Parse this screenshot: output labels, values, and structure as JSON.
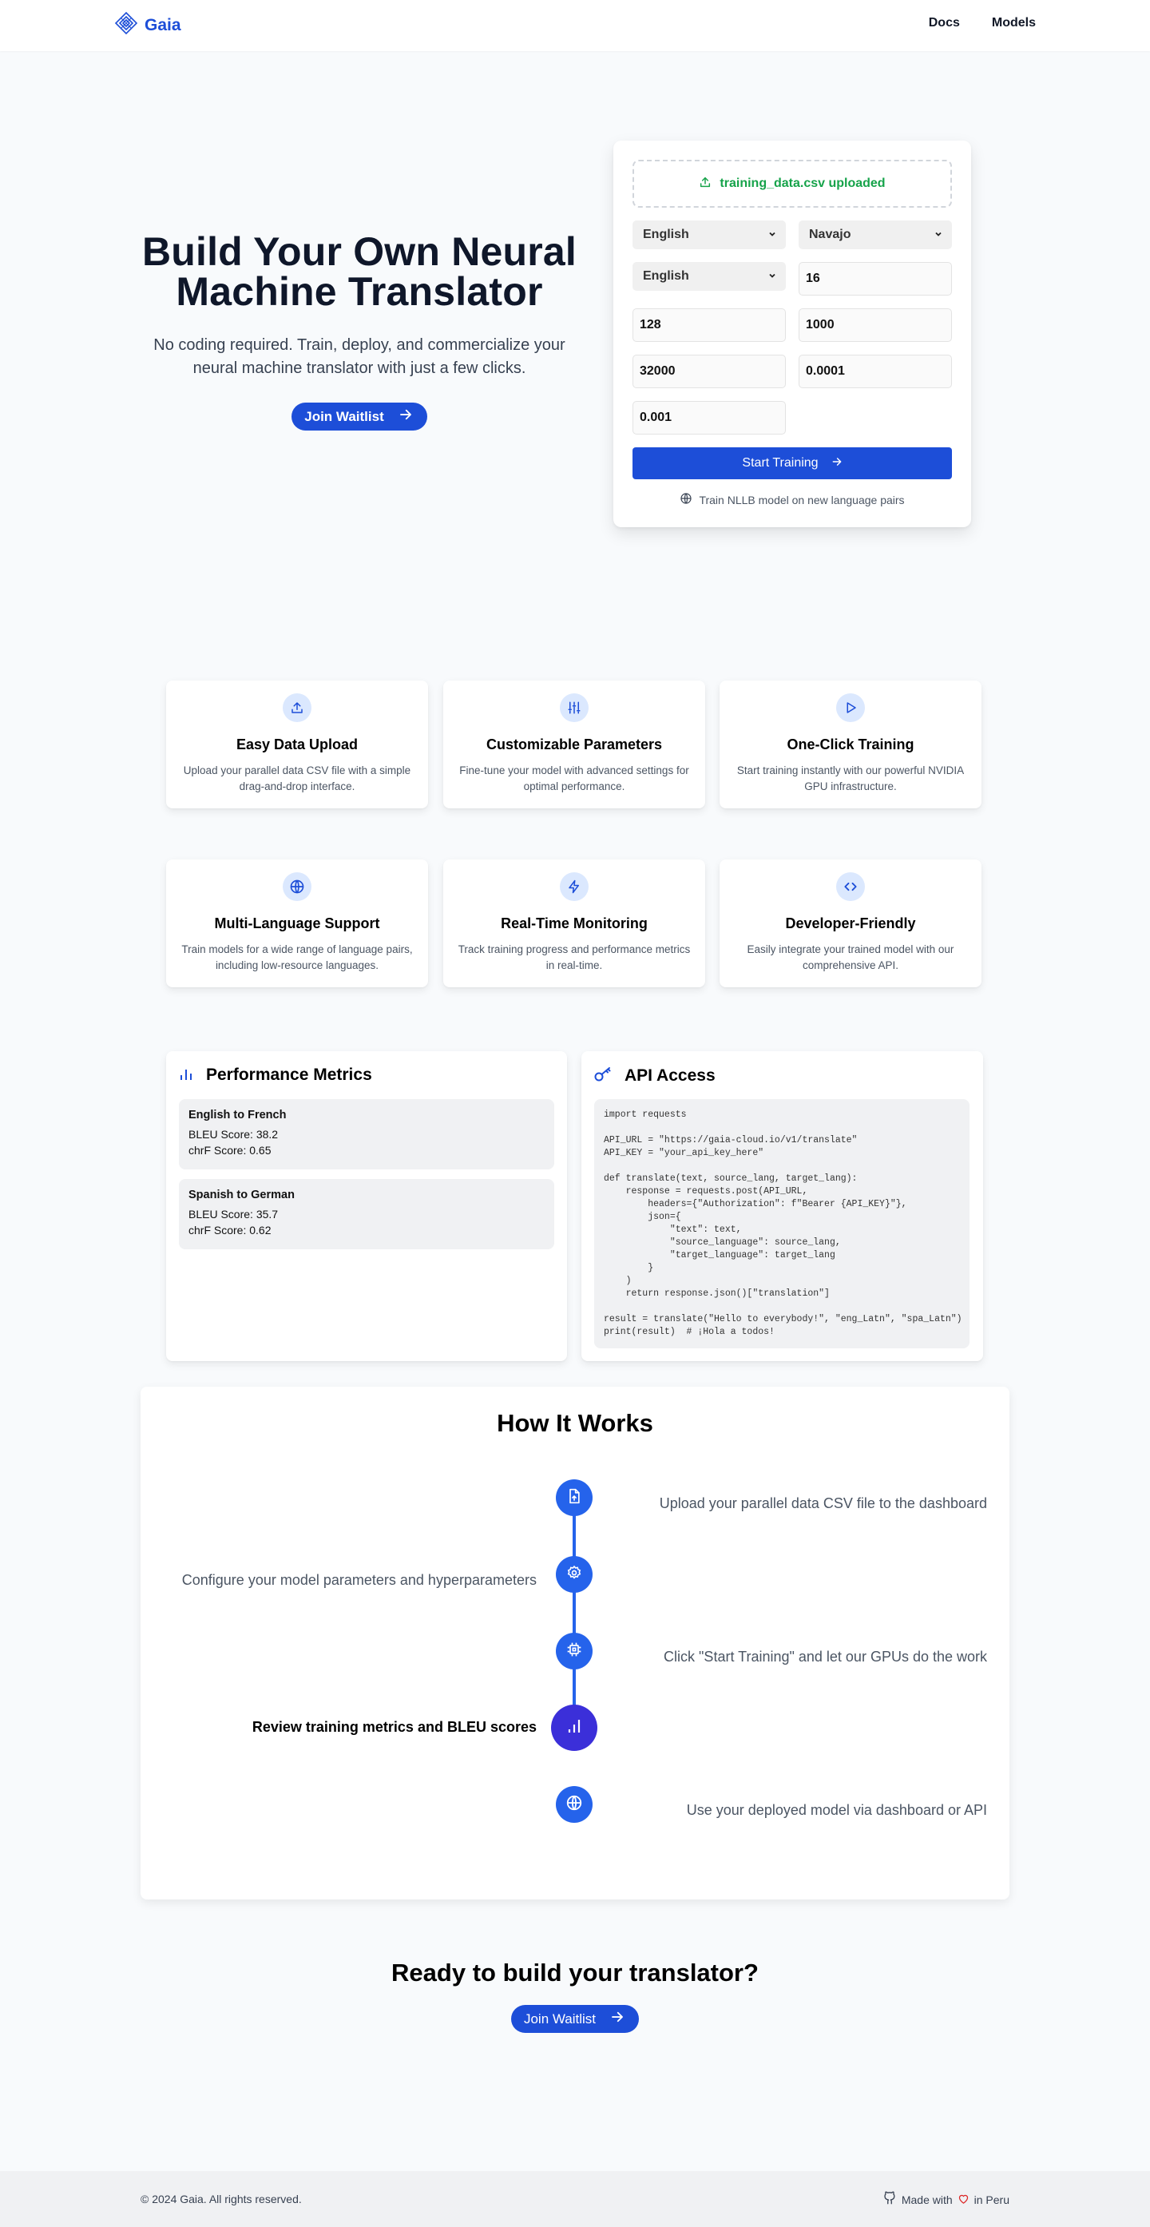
{
  "nav": {
    "brand": "Gaia",
    "links": [
      "Docs",
      "Models"
    ]
  },
  "hero": {
    "title": "Build Your Own Neural Machine Translator",
    "subtitle": "No coding required. Train, deploy, and commercialize your neural machine translator with just a few clicks.",
    "cta_label": "Join Waitlist"
  },
  "training_form": {
    "upload_status": "training_data.csv uploaded",
    "source_language": "English",
    "target_language": "Navajo",
    "third_language": "English",
    "param_values": [
      "16",
      "128",
      "1000",
      "32000",
      "0.0001",
      "0.001"
    ],
    "start_label": "Start Training",
    "note": "Train NLLB model on new language pairs"
  },
  "features": [
    {
      "icon": "upload-icon",
      "title": "Easy Data Upload",
      "desc": "Upload your parallel data CSV file with a simple drag-and-drop interface."
    },
    {
      "icon": "sliders-icon",
      "title": "Customizable Parameters",
      "desc": "Fine-tune your model with advanced settings for optimal performance."
    },
    {
      "icon": "play-icon",
      "title": "One-Click Training",
      "desc": "Start training instantly with our powerful NVIDIA GPU infrastructure."
    },
    {
      "icon": "globe-icon",
      "title": "Multi-Language Support",
      "desc": "Train models for a wide range of language pairs, including low-resource languages."
    },
    {
      "icon": "zap-icon",
      "title": "Real-Time Monitoring",
      "desc": "Track training progress and performance metrics in real-time."
    },
    {
      "icon": "code-icon",
      "title": "Developer-Friendly",
      "desc": "Easily integrate your trained model with our comprehensive API."
    }
  ],
  "metrics": {
    "title": "Performance Metrics",
    "items": [
      {
        "pair": "English to French",
        "bleu": "BLEU Score: 38.2",
        "chrf": "chrF Score: 0.65"
      },
      {
        "pair": "Spanish to German",
        "bleu": "BLEU Score: 35.7",
        "chrf": "chrF Score: 0.62"
      }
    ]
  },
  "api": {
    "title": "API Access",
    "code": "import requests\n\nAPI_URL = \"https://gaia-cloud.io/v1/translate\"\nAPI_KEY = \"your_api_key_here\"\n\ndef translate(text, source_lang, target_lang):\n    response = requests.post(API_URL,\n        headers={\"Authorization\": f\"Bearer {API_KEY}\"},\n        json={\n            \"text\": text,\n            \"source_language\": source_lang,\n            \"target_language\": target_lang\n        }\n    )\n    return response.json()[\"translation\"]\n\nresult = translate(\"Hello to everybody!\", \"eng_Latn\", \"spa_Latn\")\nprint(result)  # ¡Hola a todos!"
  },
  "how_it_works": {
    "title": "How It Works",
    "steps": [
      {
        "icon": "file-upload-icon",
        "text": "Upload your parallel data CSV file to the dashboard",
        "side": "right",
        "active": false
      },
      {
        "icon": "gear-icon",
        "text": "Configure your model parameters and hyperparameters",
        "side": "left",
        "active": false
      },
      {
        "icon": "cpu-icon",
        "text": "Click \"Start Training\" and let our GPUs do the work",
        "side": "right",
        "active": false
      },
      {
        "icon": "bar-chart-icon",
        "text": "Review training metrics and BLEU scores",
        "side": "left",
        "active": true
      },
      {
        "icon": "globe-icon",
        "text": "Use your deployed model via dashboard or API",
        "side": "right",
        "active": false
      }
    ]
  },
  "cta": {
    "title": "Ready to build your translator?",
    "button_label": "Join Waitlist"
  },
  "footer": {
    "copyright": "© 2024 Gaia. All rights reserved.",
    "made_prefix": "Made with",
    "made_suffix": "in Peru"
  },
  "colors": {
    "brand_blue": "#1d4ed8",
    "timeline_blue": "#2563eb",
    "active_step": "#3b2fd9",
    "success_green": "#16a34a",
    "heart_red": "#dc2626"
  }
}
